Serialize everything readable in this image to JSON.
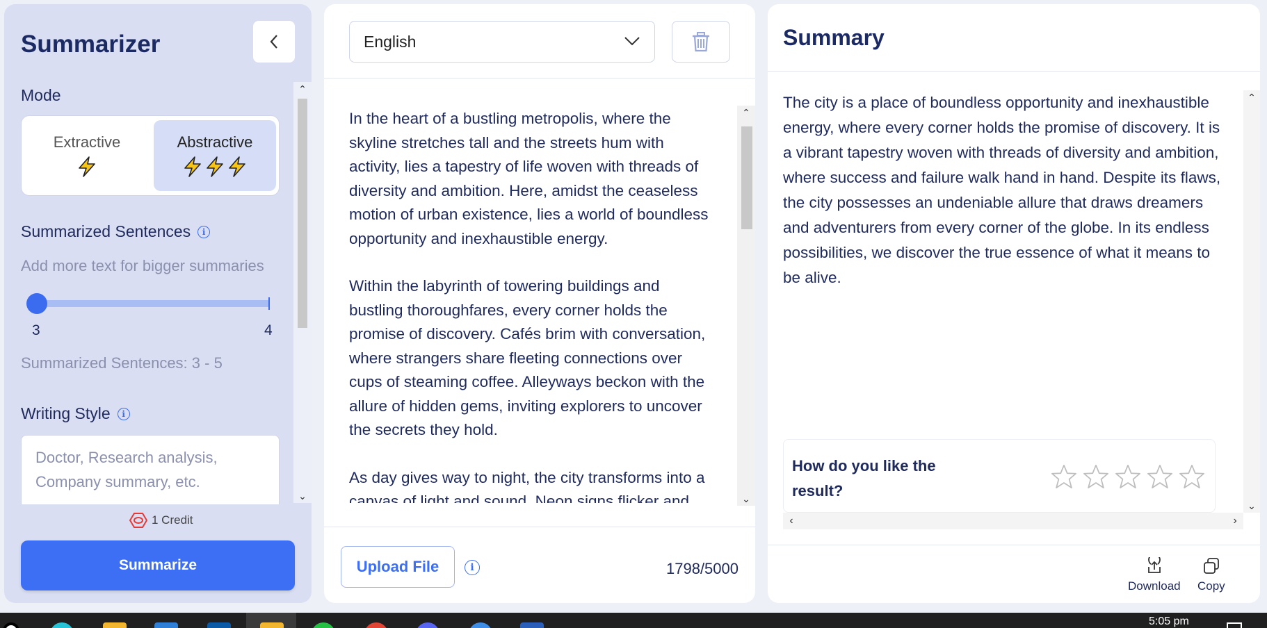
{
  "sidebar": {
    "title": "Summarizer",
    "mode_label": "Mode",
    "modes": [
      {
        "name": "Extractive",
        "bolts": 1,
        "selected": false
      },
      {
        "name": "Abstractive",
        "bolts": 3,
        "selected": true
      }
    ],
    "summarized_sentences_label": "Summarized Sentences",
    "hint": "Add more text for bigger summaries",
    "slider": {
      "min": "3",
      "max": "4",
      "value": 3
    },
    "summarized_range": "Summarized Sentences: 3 - 5",
    "writing_style_label": "Writing Style",
    "writing_style_placeholder": "Doctor, Research analysis, Company summary, etc.",
    "credit": "1 Credit",
    "summarize_button": "Summarize"
  },
  "input": {
    "language": "English",
    "paragraphs": [
      "In the heart of a bustling metropolis, where the skyline stretches tall and the streets hum with activity, lies a tapestry of life woven with threads of diversity and ambition. Here, amidst the ceaseless motion of urban existence, lies a world of boundless opportunity and inexhaustible energy.",
      "Within the labyrinth of towering buildings and bustling thoroughfares, every corner holds the promise of discovery. Cafés brim with conversation, where strangers share fleeting connections over cups of steaming coffee. Alleyways beckon with the allure of hidden gems, inviting explorers to uncover the secrets they hold.",
      "As day gives way to night, the city transforms into a canvas of light and sound. Neon signs flicker and"
    ],
    "upload_button": "Upload File",
    "char_count": "1798/5000"
  },
  "output": {
    "title": "Summary",
    "text": "The city is a place of boundless opportunity and inexhaustible energy, where every corner holds the promise of discovery. It is a vibrant tapestry woven with threads of diversity and ambition, where success and failure walk hand in hand. Despite its flaws, the city possesses an undeniable allure that draws dreamers and adventurers from every corner of the globe. In its endless possibilities, we discover the true essence of what it means to be alive.",
    "rating_question": "How do you like the result?",
    "stars": 5,
    "rating": 0,
    "download_label": "Download",
    "copy_label": "Copy"
  },
  "taskbar": {
    "time": "5:05 pm"
  },
  "colors": {
    "accent": "#3d6ff5",
    "sidebar_bg": "#d9def3",
    "bolt_fill": "#f5c518",
    "text_dark": "#1f2a5c",
    "credit_red": "#e53935"
  }
}
